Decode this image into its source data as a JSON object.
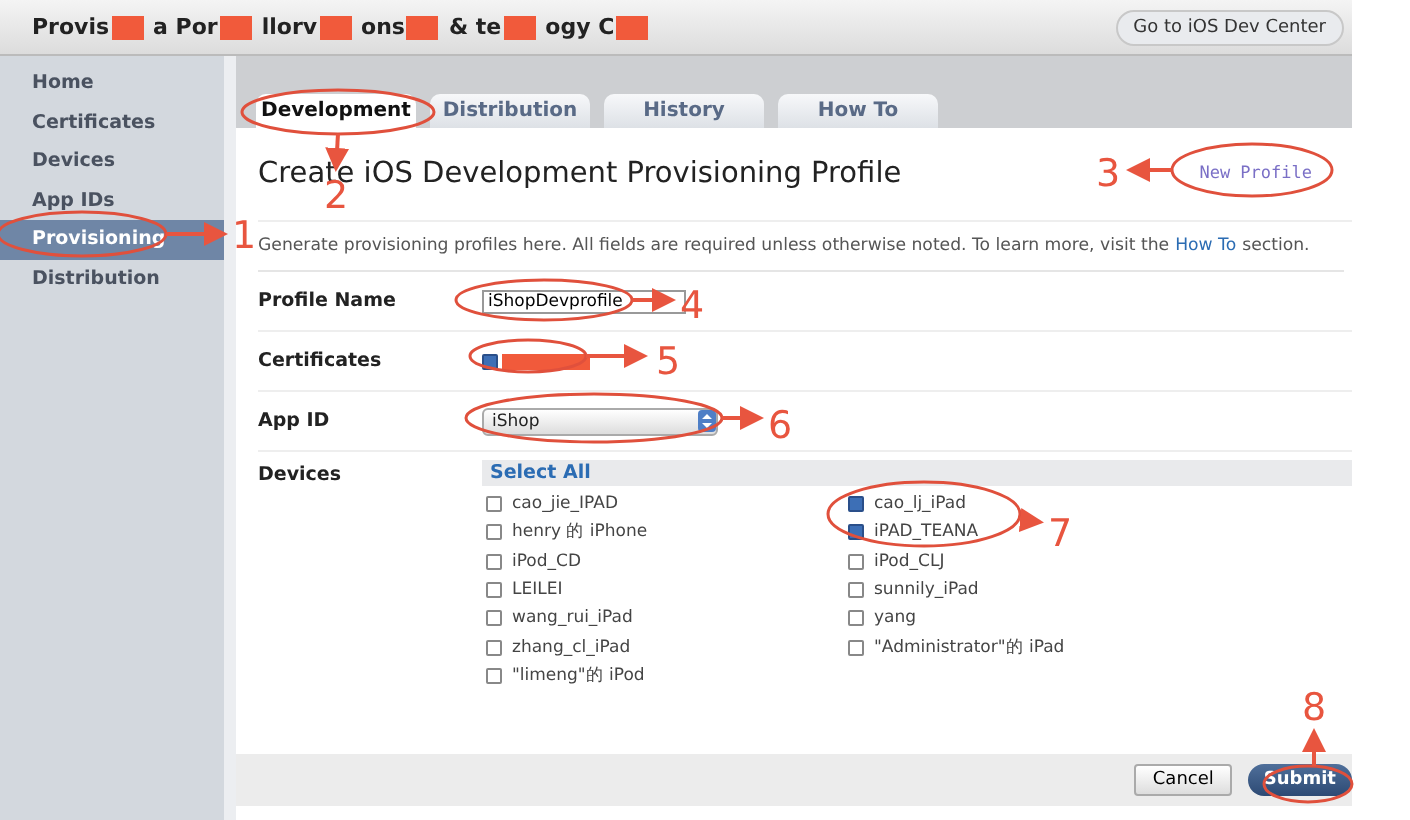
{
  "header": {
    "title_fragments": [
      "Provis",
      "a Por",
      "llorv",
      "ons",
      "& te",
      "ogy C"
    ],
    "dev_center_button": "Go to iOS Dev Center"
  },
  "sidebar": {
    "items": [
      {
        "label": "Home",
        "selected": false
      },
      {
        "label": "Certificates",
        "selected": false
      },
      {
        "label": "Devices",
        "selected": false
      },
      {
        "label": "App IDs",
        "selected": false
      },
      {
        "label": "Provisioning",
        "selected": true
      },
      {
        "label": "Distribution",
        "selected": false
      }
    ]
  },
  "tabs": [
    {
      "label": "Development",
      "selected": true
    },
    {
      "label": "Distribution",
      "selected": false
    },
    {
      "label": "History",
      "selected": false
    },
    {
      "label": "How To",
      "selected": false
    }
  ],
  "heading": "Create iOS Development Provisioning Profile",
  "new_profile_link": "New Profile",
  "intro": {
    "before": "Generate provisioning profiles here. All fields are required unless otherwise noted. To learn more, visit the",
    "link": "How To",
    "after": "section."
  },
  "form": {
    "profile_name": {
      "label": "Profile Name",
      "value": "iShopDevprofile"
    },
    "certificates": {
      "label": "Certificates",
      "checked": true
    },
    "app_id": {
      "label": "App ID",
      "value": "iShop"
    },
    "devices": {
      "label": "Devices",
      "select_all": "Select All",
      "columns": [
        [
          {
            "name": "cao_jie_IPAD",
            "checked": false
          },
          {
            "name": "henry 的 iPhone",
            "checked": false
          },
          {
            "name": "iPod_CD",
            "checked": false
          },
          {
            "name": "LEILEI",
            "checked": false
          },
          {
            "name": "wang_rui_iPad",
            "checked": false
          },
          {
            "name": "zhang_cl_iPad",
            "checked": false
          },
          {
            "name": "\"limeng\"的 iPod",
            "checked": false
          }
        ],
        [
          {
            "name": "cao_lj_iPad",
            "checked": true
          },
          {
            "name": "iPAD_TEANA",
            "checked": true
          },
          {
            "name": "iPod_CLJ",
            "checked": false
          },
          {
            "name": "sunnily_iPad",
            "checked": false
          },
          {
            "name": "yang",
            "checked": false
          },
          {
            "name": "\"Administrator\"的 iPad",
            "checked": false
          }
        ]
      ]
    }
  },
  "buttons": {
    "cancel": "Cancel",
    "submit": "Submit"
  },
  "annotations": [
    {
      "label": "1"
    },
    {
      "label": "2"
    },
    {
      "label": "3"
    },
    {
      "label": "4"
    },
    {
      "label": "5"
    },
    {
      "label": "6"
    },
    {
      "label": "7"
    },
    {
      "label": "8"
    }
  ]
}
